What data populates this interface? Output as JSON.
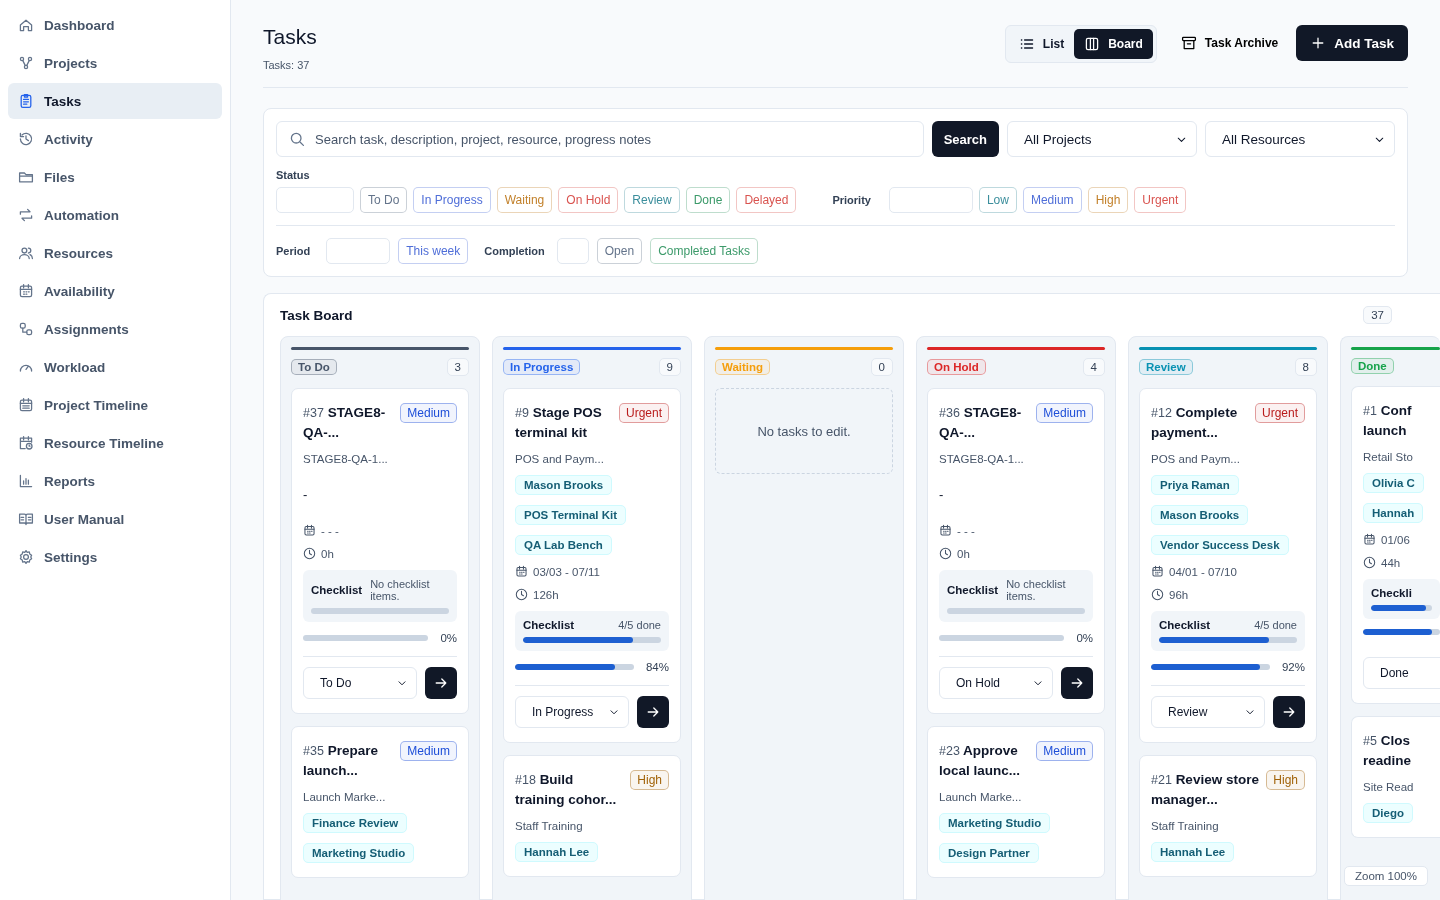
{
  "sidebar": {
    "items": [
      {
        "label": "Dashboard",
        "selected": false
      },
      {
        "label": "Projects",
        "selected": false
      },
      {
        "label": "Tasks",
        "selected": true
      },
      {
        "label": "Activity",
        "selected": false
      },
      {
        "label": "Files",
        "selected": false
      },
      {
        "label": "Automation",
        "selected": false
      },
      {
        "label": "Resources",
        "selected": false
      },
      {
        "label": "Availability",
        "selected": false
      },
      {
        "label": "Assignments",
        "selected": false
      },
      {
        "label": "Workload",
        "selected": false
      },
      {
        "label": "Project Timeline",
        "selected": false
      },
      {
        "label": "Resource Timeline",
        "selected": false
      },
      {
        "label": "Reports",
        "selected": false
      },
      {
        "label": "User Manual",
        "selected": false
      },
      {
        "label": "Settings",
        "selected": false
      }
    ]
  },
  "header": {
    "title": "Tasks",
    "subtitle": "Tasks: 37",
    "view_toggle": [
      {
        "label": "List",
        "selected": false
      },
      {
        "label": "Board",
        "selected": true
      }
    ],
    "archive_button": "Task Archive",
    "add_button": "Add Task"
  },
  "filters": {
    "search": {
      "placeholder": "Search task, description, project, resource, progress notes"
    },
    "search_button": "Search",
    "project_select": "All Projects",
    "resource_select": "All Resources",
    "status_label": "Status",
    "status_chips": [
      {
        "label": "To Do",
        "color": "#64748b"
      },
      {
        "label": "In Progress",
        "color": "#4f6ed8"
      },
      {
        "label": "Waiting",
        "color": "#c2802a"
      },
      {
        "label": "On Hold",
        "color": "#d9534f"
      },
      {
        "label": "Review",
        "color": "#3b8e9c"
      },
      {
        "label": "Done",
        "color": "#3c9a6a"
      },
      {
        "label": "Delayed",
        "color": "#d9534f"
      }
    ],
    "priority_label": "Priority",
    "priority_chips": [
      {
        "label": "Low",
        "color": "#3b8e9c"
      },
      {
        "label": "Medium",
        "color": "#4f6ed8"
      },
      {
        "label": "High",
        "color": "#c2802a"
      },
      {
        "label": "Urgent",
        "color": "#d9534f"
      }
    ],
    "period_label": "Period",
    "period_chips": [
      {
        "label": "This week",
        "color": "#4f6ed8"
      }
    ],
    "completion_label": "Completion",
    "completion_chips": [
      {
        "label": "Open",
        "color": "#64748b"
      },
      {
        "label": "Completed Tasks",
        "color": "#3c9a6a"
      }
    ]
  },
  "board": {
    "title": "Task Board",
    "count": "37",
    "columns": [
      {
        "name": "To Do",
        "color": "#475569",
        "count": "3",
        "tasks": [
          {
            "number": "#37",
            "title": "STAGE8-QA-...",
            "priority": {
              "label": "Medium",
              "color": "#1d4ed8"
            },
            "project": "STAGE8-QA-1...",
            "resource_note": "-",
            "dates": "- - -",
            "hours": "0h",
            "checklist": {
              "label": "Checklist",
              "note": "No checklist items.",
              "level": 0
            },
            "progress": {
              "level": 0,
              "reading": "0%"
            },
            "status_select": "To Do"
          },
          {
            "number": "#35",
            "title": "Prepare launch...",
            "priority": {
              "label": "Medium",
              "color": "#1d4ed8"
            },
            "project": "Launch Marke...",
            "resources": [
              "Finance Review",
              "Marketing Studio"
            ]
          }
        ]
      },
      {
        "name": "In Progress",
        "color": "#2563eb",
        "count": "9",
        "tasks": [
          {
            "number": "#9",
            "title": "Stage POS terminal kit",
            "priority": {
              "label": "Urgent",
              "color": "#b91c1c"
            },
            "project": "POS and Paym...",
            "resources": [
              "Mason Brooks",
              "POS Terminal Kit",
              "QA Lab Bench"
            ],
            "dates": "03/03 - 07/11",
            "hours": "126h",
            "checklist": {
              "label": "Checklist",
              "note": "4/5 done",
              "level": 0.8
            },
            "progress": {
              "level": 0.84,
              "reading": "84%"
            },
            "status_select": "In Progress"
          },
          {
            "number": "#18",
            "title": "Build training cohor...",
            "priority": {
              "label": "High",
              "color": "#a16207"
            },
            "project": "Staff Training",
            "resources": [
              "Hannah Lee"
            ]
          }
        ]
      },
      {
        "name": "Waiting",
        "color": "#f59e0b",
        "count": "0",
        "empty_message": "No tasks to edit."
      },
      {
        "name": "On Hold",
        "color": "#dc2626",
        "count": "4",
        "tasks": [
          {
            "number": "#36",
            "title": "STAGE8-QA-...",
            "priority": {
              "label": "Medium",
              "color": "#1d4ed8"
            },
            "project": "STAGE8-QA-1...",
            "resource_note": "-",
            "dates": "- - -",
            "hours": "0h",
            "checklist": {
              "label": "Checklist",
              "note": "No checklist items.",
              "level": 0
            },
            "progress": {
              "level": 0,
              "reading": "0%"
            },
            "status_select": "On Hold"
          },
          {
            "number": "#23",
            "title": "Approve local launc...",
            "priority": {
              "label": "Medium",
              "color": "#1d4ed8"
            },
            "project": "Launch Marke...",
            "resources": [
              "Marketing Studio",
              "Design Partner"
            ]
          }
        ]
      },
      {
        "name": "Review",
        "color": "#0891b2",
        "count": "8",
        "tasks": [
          {
            "number": "#12",
            "title": "Complete payment...",
            "priority": {
              "label": "Urgent",
              "color": "#b91c1c"
            },
            "project": "POS and Paym...",
            "resources": [
              "Priya Raman",
              "Mason Brooks",
              "Vendor Success Desk"
            ],
            "dates": "04/01 - 07/10",
            "hours": "96h",
            "checklist": {
              "label": "Checklist",
              "note": "4/5 done",
              "level": 0.8
            },
            "progress": {
              "level": 0.92,
              "reading": "92%"
            },
            "status_select": "Review"
          },
          {
            "number": "#21",
            "title": "Review store manager...",
            "priority": {
              "label": "High",
              "color": "#a16207"
            },
            "project": "Staff Training",
            "resources": [
              "Hannah Lee"
            ]
          }
        ]
      },
      {
        "name": "Done",
        "color": "#16a34a",
        "tasks": [
          {
            "number": "#1",
            "title": "Conf launch",
            "project": "Retail Sto",
            "resources": [
              "Olivia C",
              "Hannah"
            ],
            "dates": "01/06",
            "hours": "44h",
            "checklist": {
              "label": "Checkli",
              "level": 0.9
            },
            "progress": {
              "level": 0.9
            },
            "status_select": "Done"
          },
          {
            "number": "#5",
            "title": "Clos readine",
            "project": "Site Read",
            "resources": [
              "Diego"
            ]
          }
        ]
      }
    ]
  },
  "zoom_badge": "Zoom 100%"
}
